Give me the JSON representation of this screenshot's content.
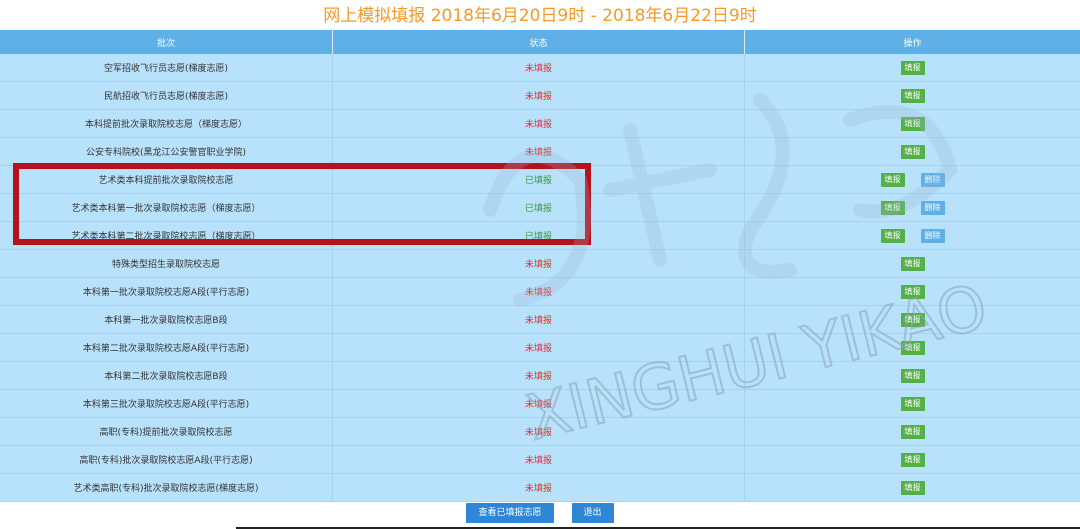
{
  "title": "网上模拟填报 2018年6月20日9时 - 2018年6月22日9时",
  "table": {
    "headers": [
      "批次",
      "状态",
      "操作"
    ],
    "rows": [
      {
        "name": "空军招收飞行员志愿(梯度志愿)",
        "status": "未填报",
        "state": "unfilled",
        "actions": [
          "填报"
        ]
      },
      {
        "name": "民航招收飞行员志愿(梯度志愿)",
        "status": "未填报",
        "state": "unfilled",
        "actions": [
          "填报"
        ]
      },
      {
        "name": "本科提前批次录取院校志愿（梯度志愿）",
        "status": "未填报",
        "state": "unfilled",
        "actions": [
          "填报"
        ]
      },
      {
        "name": "公安专科院校(黑龙江公安警官职业学院)",
        "status": "未填报",
        "state": "unfilled",
        "actions": [
          "填报"
        ]
      },
      {
        "name": "艺术类本科提前批次录取院校志愿",
        "status": "已填报",
        "state": "filled",
        "actions": [
          "填报",
          "删除"
        ]
      },
      {
        "name": "艺术类本科第一批次录取院校志愿（梯度志愿）",
        "status": "已填报",
        "state": "filled",
        "actions": [
          "填报",
          "删除"
        ]
      },
      {
        "name": "艺术类本科第二批次录取院校志愿（梯度志愿）",
        "status": "已填报",
        "state": "filled",
        "actions": [
          "填报",
          "删除"
        ]
      },
      {
        "name": "特殊类型招生录取院校志愿",
        "status": "未填报",
        "state": "unfilled",
        "actions": [
          "填报"
        ]
      },
      {
        "name": "本科第一批次录取院校志愿A段(平行志愿)",
        "status": "未填报",
        "state": "unfilled",
        "actions": [
          "填报"
        ]
      },
      {
        "name": "本科第一批次录取院校志愿B段",
        "status": "未填报",
        "state": "unfilled",
        "actions": [
          "填报"
        ]
      },
      {
        "name": "本科第二批次录取院校志愿A段(平行志愿)",
        "status": "未填报",
        "state": "unfilled",
        "actions": [
          "填报"
        ]
      },
      {
        "name": "本科第二批次录取院校志愿B段",
        "status": "未填报",
        "state": "unfilled",
        "actions": [
          "填报"
        ]
      },
      {
        "name": "本科第三批次录取院校志愿A段(平行志愿)",
        "status": "未填报",
        "state": "unfilled",
        "actions": [
          "填报"
        ]
      },
      {
        "name": "高职(专科)提前批次录取院校志愿",
        "status": "未填报",
        "state": "unfilled",
        "actions": [
          "填报"
        ]
      },
      {
        "name": "高职(专科)批次录取院校志愿A段(平行志愿)",
        "status": "未填报",
        "state": "unfilled",
        "actions": [
          "填报"
        ]
      },
      {
        "name": "艺术类高职(专科)批次录取院校志愿(梯度志愿)",
        "status": "未填报",
        "state": "unfilled",
        "actions": [
          "填报"
        ]
      }
    ]
  },
  "footer": {
    "view_button": "查看已填报志愿",
    "exit_button": "退出"
  },
  "watermark": {
    "chinese": "星辉艺考",
    "latin": "XINGHUI YIKAO"
  },
  "colors": {
    "title": "#f39a2a",
    "header_bg": "#5fb0e6",
    "row_bg": "#b8e1fb",
    "unfilled": "#ee2b2b",
    "filled": "#3c9a3c",
    "fill_button": "#55b04a",
    "delete_button": "#5fb0e6",
    "footer_button": "#2f86d6",
    "highlight_border": "#b5121b"
  }
}
